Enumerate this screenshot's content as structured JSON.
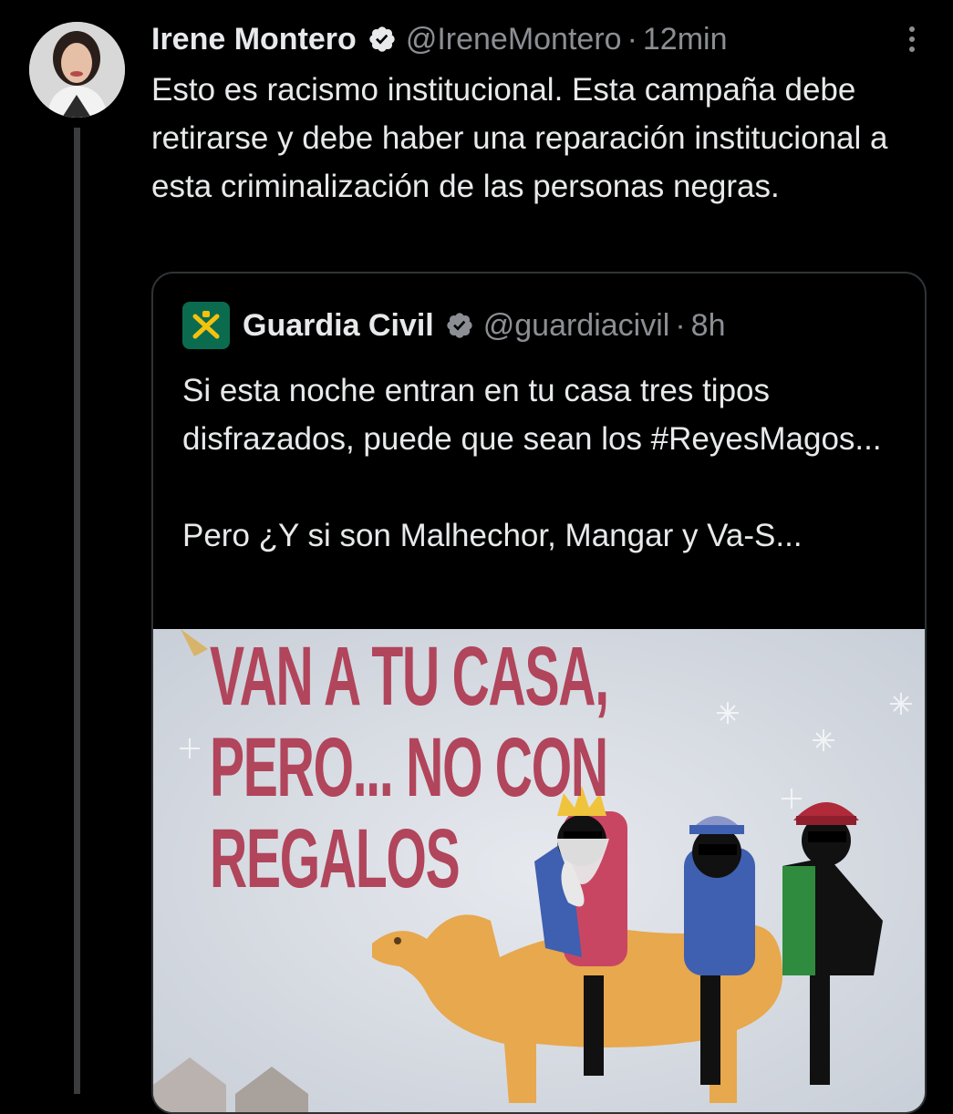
{
  "tweet": {
    "author_name": "Irene Montero",
    "handle": "@IreneMontero",
    "separator": "·",
    "time": "12min",
    "text": "Esto es racismo institucional. Esta campaña debe retirarse y debe haber una reparación institucional a esta criminalización de las personas negras."
  },
  "quoted_tweet": {
    "author_name": "Guardia Civil",
    "handle": "@guardiacivil",
    "separator": "·",
    "time": "8h",
    "text_line1": "Si esta noche entran en tu casa tres tipos disfrazados, puede que sean los #ReyesMagos...",
    "text_line2": "Pero ¿Y si son Malhechor, Mangar y Va-S...",
    "image_poster": {
      "line1": "VAN A TU CASA,",
      "line2": "PERO... NO CON",
      "line3": "REGALOS"
    }
  },
  "colors": {
    "background": "#000000",
    "text": "#e7e9ea",
    "muted": "#8b8f93",
    "border": "#2f3336",
    "poster_title": "#b1455b"
  },
  "icons": {
    "verified": "verified-badge-icon",
    "more": "more-options-icon",
    "logo": "guardia-civil-logo"
  }
}
